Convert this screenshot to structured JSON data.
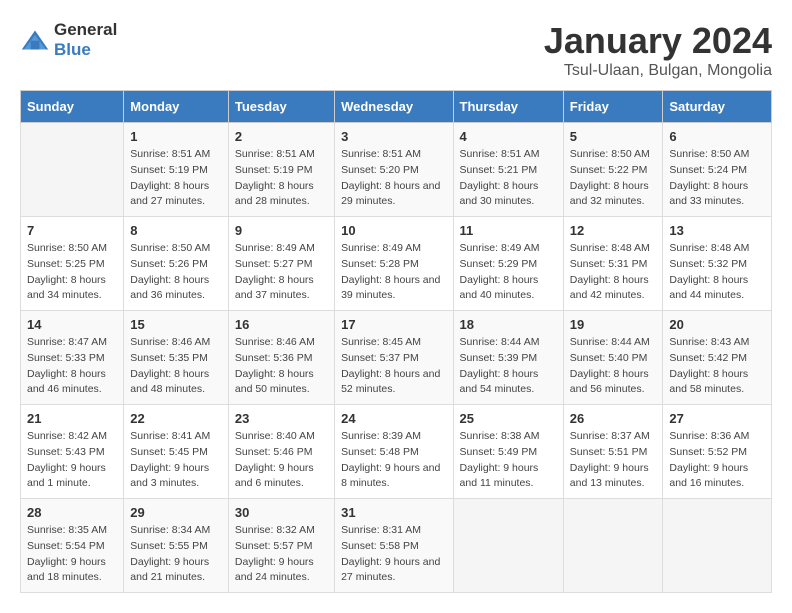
{
  "logo": {
    "general": "General",
    "blue": "Blue"
  },
  "title": {
    "month": "January 2024",
    "location": "Tsul-Ulaan, Bulgan, Mongolia"
  },
  "weekdays": [
    "Sunday",
    "Monday",
    "Tuesday",
    "Wednesday",
    "Thursday",
    "Friday",
    "Saturday"
  ],
  "weeks": [
    [
      {
        "day": "",
        "sunrise": "",
        "sunset": "",
        "daylight": ""
      },
      {
        "day": "1",
        "sunrise": "Sunrise: 8:51 AM",
        "sunset": "Sunset: 5:19 PM",
        "daylight": "Daylight: 8 hours and 27 minutes."
      },
      {
        "day": "2",
        "sunrise": "Sunrise: 8:51 AM",
        "sunset": "Sunset: 5:19 PM",
        "daylight": "Daylight: 8 hours and 28 minutes."
      },
      {
        "day": "3",
        "sunrise": "Sunrise: 8:51 AM",
        "sunset": "Sunset: 5:20 PM",
        "daylight": "Daylight: 8 hours and 29 minutes."
      },
      {
        "day": "4",
        "sunrise": "Sunrise: 8:51 AM",
        "sunset": "Sunset: 5:21 PM",
        "daylight": "Daylight: 8 hours and 30 minutes."
      },
      {
        "day": "5",
        "sunrise": "Sunrise: 8:50 AM",
        "sunset": "Sunset: 5:22 PM",
        "daylight": "Daylight: 8 hours and 32 minutes."
      },
      {
        "day": "6",
        "sunrise": "Sunrise: 8:50 AM",
        "sunset": "Sunset: 5:24 PM",
        "daylight": "Daylight: 8 hours and 33 minutes."
      }
    ],
    [
      {
        "day": "7",
        "sunrise": "Sunrise: 8:50 AM",
        "sunset": "Sunset: 5:25 PM",
        "daylight": "Daylight: 8 hours and 34 minutes."
      },
      {
        "day": "8",
        "sunrise": "Sunrise: 8:50 AM",
        "sunset": "Sunset: 5:26 PM",
        "daylight": "Daylight: 8 hours and 36 minutes."
      },
      {
        "day": "9",
        "sunrise": "Sunrise: 8:49 AM",
        "sunset": "Sunset: 5:27 PM",
        "daylight": "Daylight: 8 hours and 37 minutes."
      },
      {
        "day": "10",
        "sunrise": "Sunrise: 8:49 AM",
        "sunset": "Sunset: 5:28 PM",
        "daylight": "Daylight: 8 hours and 39 minutes."
      },
      {
        "day": "11",
        "sunrise": "Sunrise: 8:49 AM",
        "sunset": "Sunset: 5:29 PM",
        "daylight": "Daylight: 8 hours and 40 minutes."
      },
      {
        "day": "12",
        "sunrise": "Sunrise: 8:48 AM",
        "sunset": "Sunset: 5:31 PM",
        "daylight": "Daylight: 8 hours and 42 minutes."
      },
      {
        "day": "13",
        "sunrise": "Sunrise: 8:48 AM",
        "sunset": "Sunset: 5:32 PM",
        "daylight": "Daylight: 8 hours and 44 minutes."
      }
    ],
    [
      {
        "day": "14",
        "sunrise": "Sunrise: 8:47 AM",
        "sunset": "Sunset: 5:33 PM",
        "daylight": "Daylight: 8 hours and 46 minutes."
      },
      {
        "day": "15",
        "sunrise": "Sunrise: 8:46 AM",
        "sunset": "Sunset: 5:35 PM",
        "daylight": "Daylight: 8 hours and 48 minutes."
      },
      {
        "day": "16",
        "sunrise": "Sunrise: 8:46 AM",
        "sunset": "Sunset: 5:36 PM",
        "daylight": "Daylight: 8 hours and 50 minutes."
      },
      {
        "day": "17",
        "sunrise": "Sunrise: 8:45 AM",
        "sunset": "Sunset: 5:37 PM",
        "daylight": "Daylight: 8 hours and 52 minutes."
      },
      {
        "day": "18",
        "sunrise": "Sunrise: 8:44 AM",
        "sunset": "Sunset: 5:39 PM",
        "daylight": "Daylight: 8 hours and 54 minutes."
      },
      {
        "day": "19",
        "sunrise": "Sunrise: 8:44 AM",
        "sunset": "Sunset: 5:40 PM",
        "daylight": "Daylight: 8 hours and 56 minutes."
      },
      {
        "day": "20",
        "sunrise": "Sunrise: 8:43 AM",
        "sunset": "Sunset: 5:42 PM",
        "daylight": "Daylight: 8 hours and 58 minutes."
      }
    ],
    [
      {
        "day": "21",
        "sunrise": "Sunrise: 8:42 AM",
        "sunset": "Sunset: 5:43 PM",
        "daylight": "Daylight: 9 hours and 1 minute."
      },
      {
        "day": "22",
        "sunrise": "Sunrise: 8:41 AM",
        "sunset": "Sunset: 5:45 PM",
        "daylight": "Daylight: 9 hours and 3 minutes."
      },
      {
        "day": "23",
        "sunrise": "Sunrise: 8:40 AM",
        "sunset": "Sunset: 5:46 PM",
        "daylight": "Daylight: 9 hours and 6 minutes."
      },
      {
        "day": "24",
        "sunrise": "Sunrise: 8:39 AM",
        "sunset": "Sunset: 5:48 PM",
        "daylight": "Daylight: 9 hours and 8 minutes."
      },
      {
        "day": "25",
        "sunrise": "Sunrise: 8:38 AM",
        "sunset": "Sunset: 5:49 PM",
        "daylight": "Daylight: 9 hours and 11 minutes."
      },
      {
        "day": "26",
        "sunrise": "Sunrise: 8:37 AM",
        "sunset": "Sunset: 5:51 PM",
        "daylight": "Daylight: 9 hours and 13 minutes."
      },
      {
        "day": "27",
        "sunrise": "Sunrise: 8:36 AM",
        "sunset": "Sunset: 5:52 PM",
        "daylight": "Daylight: 9 hours and 16 minutes."
      }
    ],
    [
      {
        "day": "28",
        "sunrise": "Sunrise: 8:35 AM",
        "sunset": "Sunset: 5:54 PM",
        "daylight": "Daylight: 9 hours and 18 minutes."
      },
      {
        "day": "29",
        "sunrise": "Sunrise: 8:34 AM",
        "sunset": "Sunset: 5:55 PM",
        "daylight": "Daylight: 9 hours and 21 minutes."
      },
      {
        "day": "30",
        "sunrise": "Sunrise: 8:32 AM",
        "sunset": "Sunset: 5:57 PM",
        "daylight": "Daylight: 9 hours and 24 minutes."
      },
      {
        "day": "31",
        "sunrise": "Sunrise: 8:31 AM",
        "sunset": "Sunset: 5:58 PM",
        "daylight": "Daylight: 9 hours and 27 minutes."
      },
      {
        "day": "",
        "sunrise": "",
        "sunset": "",
        "daylight": ""
      },
      {
        "day": "",
        "sunrise": "",
        "sunset": "",
        "daylight": ""
      },
      {
        "day": "",
        "sunrise": "",
        "sunset": "",
        "daylight": ""
      }
    ]
  ]
}
